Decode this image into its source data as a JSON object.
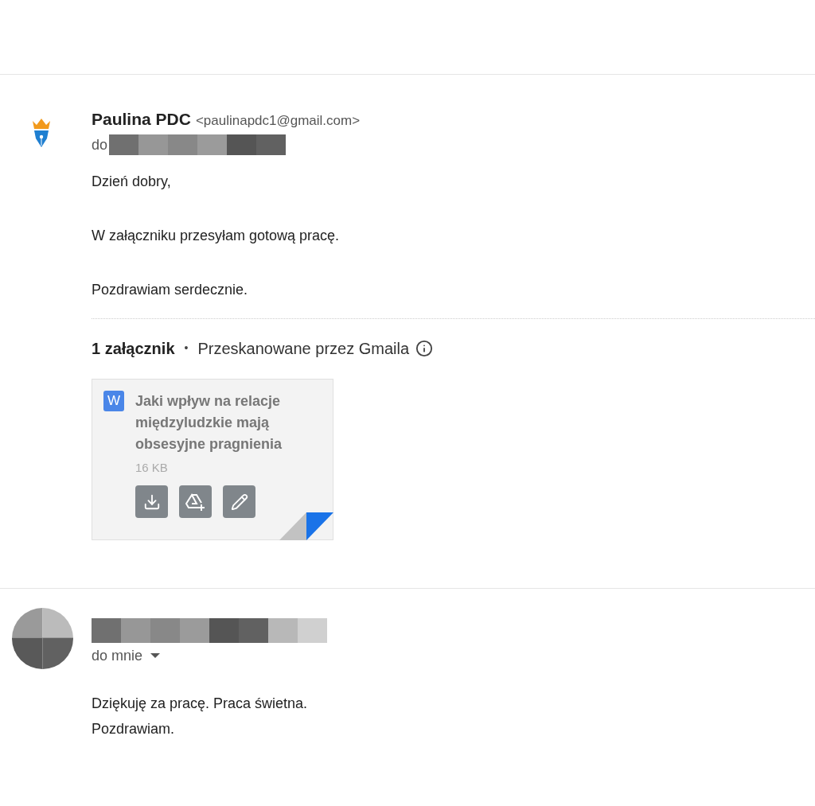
{
  "messages": [
    {
      "kind": "sent",
      "sender_name": "Paulina PDC",
      "sender_email": "<paulinapdc1@gmail.com>",
      "recipient_label": "do",
      "body": [
        "Dzień dobry,",
        "W załączniku przesyłam gotową pracę.",
        "Pozdrawiam serdecznie."
      ],
      "attachments_header": {
        "count": "1 załącznik",
        "separator": "•",
        "scan_note": "Przeskanowane przez Gmaila"
      },
      "attachments": [
        {
          "type_letter": "W",
          "title": "Jaki wpływ na relacje międzyludzkie mają obsesyjne pragnienia",
          "size": "16 KB"
        }
      ]
    },
    {
      "kind": "received",
      "recipient_label": "do mnie",
      "body": [
        "Dziękuję za pracę. Praca świetna.\nPozdrawiam."
      ]
    }
  ]
}
